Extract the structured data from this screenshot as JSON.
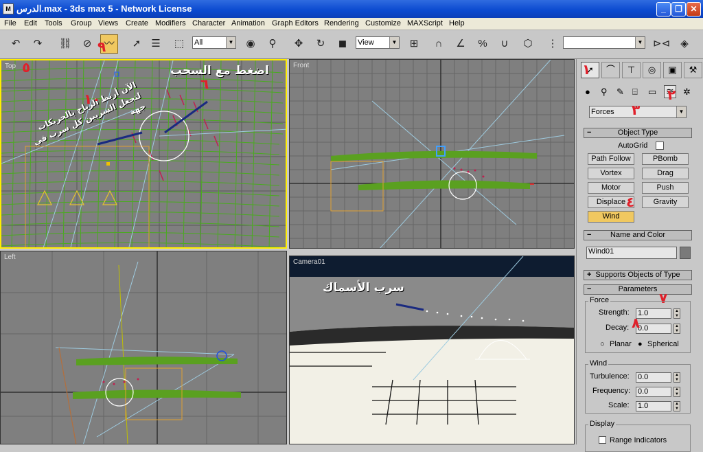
{
  "window": {
    "title": "الدرس.max - 3ds max 5 - Network License",
    "icon": "3ds-max-icon"
  },
  "menu": [
    "File",
    "Edit",
    "Tools",
    "Group",
    "Views",
    "Create",
    "Modifiers",
    "Character",
    "Animation",
    "Graph Editors",
    "Rendering",
    "Customize",
    "MAXScript",
    "Help"
  ],
  "toolbar": {
    "selection_filter": "All",
    "reference_coord": "View",
    "named_selection": "",
    "keyboard_shortcut_label": "ABC"
  },
  "viewports": {
    "top": "Top",
    "front": "Front",
    "left": "Left",
    "camera": "Camera01"
  },
  "command_panel": {
    "category_dropdown": "Forces",
    "object_type_title": "Object Type",
    "autogrid_label": "AutoGrid",
    "buttons": [
      "Path Follow",
      "PBomb",
      "Vortex",
      "Drag",
      "Motor",
      "Push",
      "Displace",
      "Gravity",
      "Wind"
    ],
    "name_color_title": "Name and Color",
    "object_name": "Wind01",
    "supports_title": "Supports Objects of Type",
    "parameters_title": "Parameters",
    "force_group": "Force",
    "strength_label": "Strength:",
    "strength_value": "1.0",
    "decay_label": "Decay:",
    "decay_value": "0.0",
    "planar_label": "Planar",
    "spherical_label": "Spherical",
    "wind_group": "Wind",
    "turbulence_label": "Turbulence:",
    "turbulence_value": "0.0",
    "frequency_label": "Frequency:",
    "frequency_value": "0.0",
    "scale_label": "Scale:",
    "scale_value": "1.0",
    "display_group": "Display",
    "range_indicators_label": "Range Indicators"
  },
  "annotations": {
    "press_drag": "اضغط مع السحب",
    "link_instruction": "الآن أربط الرياح بالحريكات لتجعل السربين كل سرب في جهة",
    "fish_school": "سرب الأسماك",
    "badges": [
      "١",
      "٢",
      "٣",
      "٤",
      "٥",
      "٦",
      "٧",
      "٨",
      "٩",
      "١٠"
    ]
  },
  "colors": {
    "active_yellow": "#f0c860",
    "title_blue": "#0a49cf",
    "viewport_gray": "#7f7f7f",
    "badge_red": "#e0202a"
  }
}
